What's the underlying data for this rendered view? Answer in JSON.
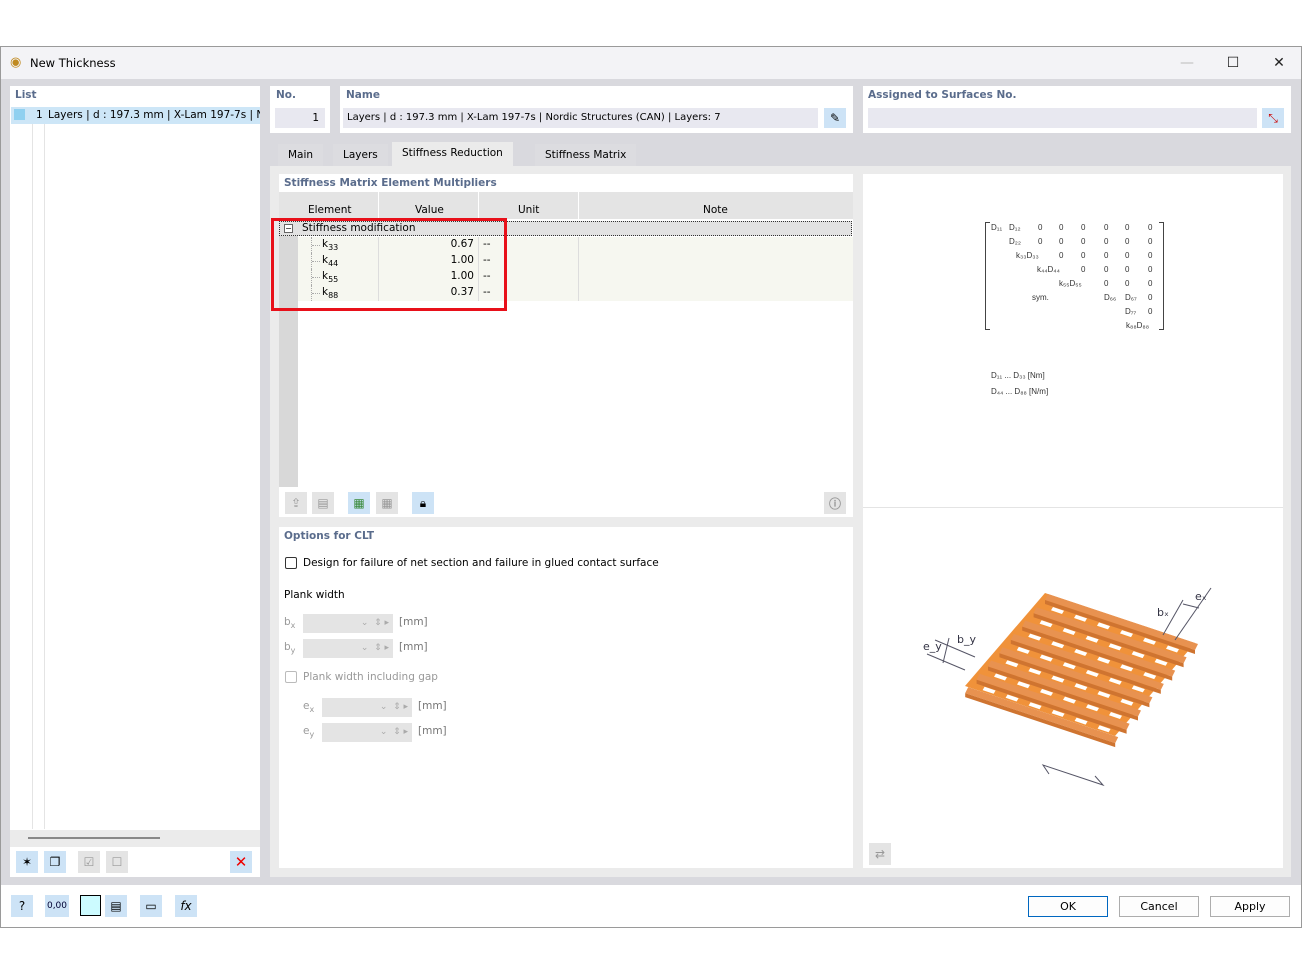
{
  "window": {
    "title": "New Thickness",
    "minimize": "—",
    "maximize": "☐",
    "close": "✕"
  },
  "list": {
    "header": "List",
    "items": [
      {
        "no": "1",
        "label": "Layers | d : 197.3 mm | X-Lam 197-7s | Nordic Structures (CAN) | Layers: 7",
        "color": "#8fd0f0"
      }
    ]
  },
  "no": {
    "label": "No.",
    "value": "1"
  },
  "name": {
    "label": "Name",
    "value": "Layers | d : 197.3 mm | X-Lam 197-7s | Nordic Structures (CAN) | Layers: 7"
  },
  "assigned": {
    "label": "Assigned to Surfaces No.",
    "value": ""
  },
  "tabs": [
    {
      "label": "Main"
    },
    {
      "label": "Layers"
    },
    {
      "label": "Stiffness Reduction",
      "active": true
    },
    {
      "label": "Stiffness Matrix"
    }
  ],
  "multipliers": {
    "title": "Stiffness Matrix Element Multipliers",
    "columns": [
      "Element",
      "Value",
      "Unit",
      "Note"
    ],
    "group": "Stiffness modification",
    "rows": [
      {
        "element": "k",
        "sub": "33",
        "value": "0.67",
        "unit": "--",
        "note": ""
      },
      {
        "element": "k",
        "sub": "44",
        "value": "1.00",
        "unit": "--",
        "note": ""
      },
      {
        "element": "k",
        "sub": "55",
        "value": "1.00",
        "unit": "--",
        "note": ""
      },
      {
        "element": "k",
        "sub": "88",
        "value": "0.37",
        "unit": "--",
        "note": ""
      }
    ],
    "highlight_color": "#e8101a"
  },
  "clt": {
    "title": "Options for CLT",
    "design_check": {
      "label": "Design for failure of net section and failure in glued contact surface",
      "checked": false
    },
    "plank_width": "Plank width",
    "bx": {
      "label": "b",
      "sub": "x",
      "value": "",
      "unit": "[mm]"
    },
    "by": {
      "label": "b",
      "sub": "y",
      "value": "",
      "unit": "[mm]"
    },
    "gap": {
      "label": "Plank width including gap",
      "checked": false
    },
    "ex": {
      "label": "e",
      "sub": "x",
      "value": "",
      "unit": "[mm]"
    },
    "ey": {
      "label": "e",
      "sub": "y",
      "value": "",
      "unit": "[mm]"
    }
  },
  "matrix": {
    "rows": [
      [
        "D₁₁",
        "D₁₂",
        "0",
        "0",
        "0",
        "0",
        "0",
        "0"
      ],
      [
        "",
        "D₂₂",
        "0",
        "0",
        "0",
        "0",
        "0",
        "0"
      ],
      [
        "",
        "",
        "k₃₃D₃₃",
        "0",
        "0",
        "0",
        "0",
        "0"
      ],
      [
        "",
        "",
        "",
        "k₄₄D₄₄",
        "0",
        "0",
        "0",
        "0"
      ],
      [
        "",
        "",
        "",
        "",
        "k₅₅D₅₅",
        "0",
        "0",
        "0"
      ],
      [
        "",
        "",
        "sym.",
        "",
        "",
        "D₆₆",
        "D₆₇",
        "0"
      ],
      [
        "",
        "",
        "",
        "",
        "",
        "",
        "D₇₇",
        "0"
      ],
      [
        "",
        "",
        "",
        "",
        "",
        "",
        "",
        "k₈₈D₈₈"
      ]
    ],
    "legend": [
      "D₁₁ ... D₃₃  [Nm]",
      "D₄₄ ... D₈₈  [N/m]"
    ]
  },
  "figure": {
    "labels": {
      "bx": "bₓ",
      "ex": "eₓ",
      "by": "b_y",
      "ey": "e_y"
    },
    "color": "#f0923a"
  },
  "footer": {
    "ok": "OK",
    "cancel": "Cancel",
    "apply": "Apply",
    "units_icon_text": "0,00"
  }
}
